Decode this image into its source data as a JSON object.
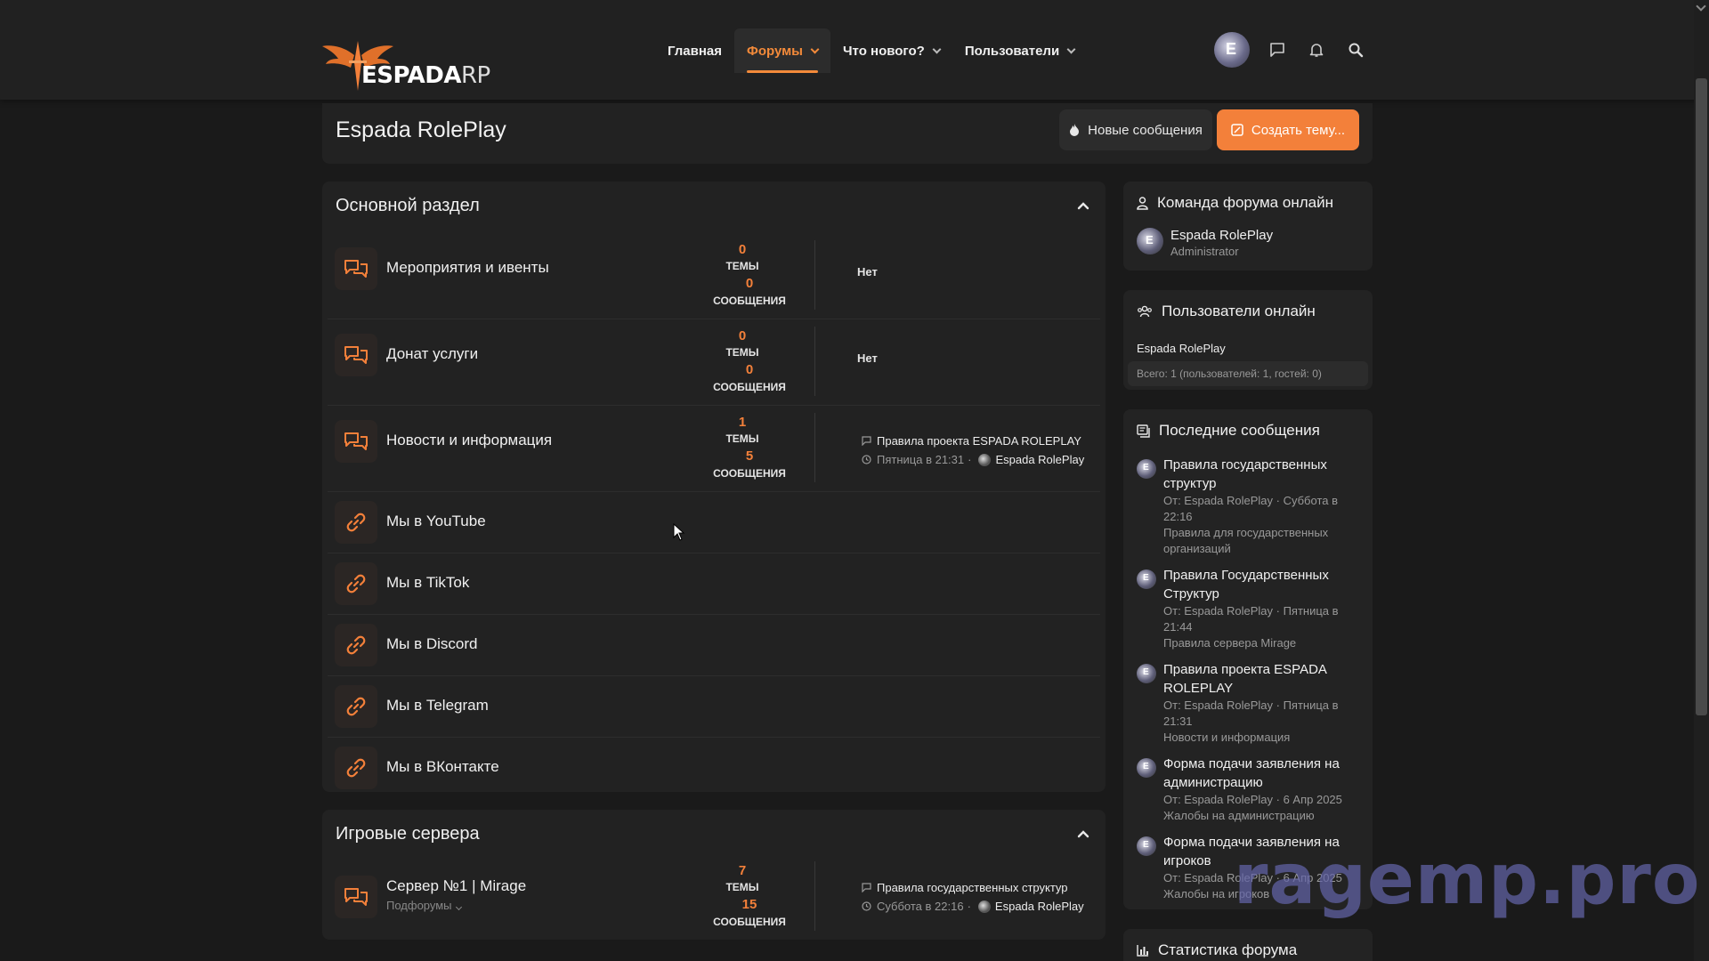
{
  "colors": {
    "accent": "#f3803a",
    "background": "#1a1a1a",
    "panel": "#222222"
  },
  "header": {
    "logo_main": "ESPADA",
    "logo_suffix": "RP",
    "nav": [
      {
        "label": "Главная"
      },
      {
        "label": "Форумы"
      },
      {
        "label": "Что нового?"
      },
      {
        "label": "Пользователи"
      }
    ],
    "icons": [
      "avatar",
      "chat-icon",
      "bell-icon",
      "search-icon"
    ]
  },
  "title_bar": {
    "title": "Espada RolePlay",
    "new_posts_label": "Новые сообщения",
    "create_thread_label": "Создать тему..."
  },
  "main_section": {
    "title": "Основной раздел",
    "nodes": [
      {
        "title": "Мероприятия и ивенты",
        "threads": "0",
        "threads_label": "ТЕМЫ",
        "messages": "0",
        "messages_label": "СООБЩЕНИЯ",
        "last": "Нет"
      },
      {
        "title": "Донат услуги",
        "threads": "0",
        "threads_label": "ТЕМЫ",
        "messages": "0",
        "messages_label": "СООБЩЕНИЯ",
        "last": "Нет"
      },
      {
        "title": "Новости и информация",
        "threads": "1",
        "threads_label": "ТЕМЫ",
        "messages": "5",
        "messages_label": "СООБЩЕНИЯ",
        "last_title": "Правила проекта ESPADA ROLEPLAY",
        "last_date": "Пятница в 21:31",
        "last_user": "Espada RolePlay"
      }
    ],
    "links": [
      {
        "title": "Мы в YouTube"
      },
      {
        "title": "Мы в TikTok"
      },
      {
        "title": "Мы в Discord"
      },
      {
        "title": "Мы в Telegram"
      },
      {
        "title": "Мы в ВКонтакте"
      }
    ]
  },
  "servers_section": {
    "title": "Игровые сервера",
    "nodes": [
      {
        "title": "Сервер №1 | Mirage",
        "subforums": "Подфорумы",
        "threads": "7",
        "threads_label": "ТЕМЫ",
        "messages": "15",
        "messages_label": "СООБЩЕНИЯ",
        "last_title": "Правила государственных структур",
        "last_date": "Суббота в 22:16",
        "last_user": "Espada RolePlay"
      }
    ]
  },
  "sidebar": {
    "team": {
      "title": "Команда форума онлайн",
      "name": "Espada RolePlay",
      "role": "Administrator"
    },
    "online": {
      "title": "Пользователи онлайн",
      "name": "Espada RolePlay",
      "total": "Всего: 1 (пользователей: 1, гостей: 0)"
    },
    "latest": {
      "title": "Последние сообщения",
      "posts": [
        {
          "title": "Правила государственных структур",
          "meta": "От: Espada RolePlay · Суббота в 22:16",
          "forum": "Правила для государственных организаций"
        },
        {
          "title": "Правила Государственных Структур",
          "meta": "От: Espada RolePlay · Пятница в 21:44",
          "forum": "Правила сервера Mirage"
        },
        {
          "title": "Правила проекта ESPADA ROLEPLAY",
          "meta": "От: Espada RolePlay · Пятница в 21:31",
          "forum": "Новости и информация"
        },
        {
          "title": "Форма подачи заявления на администрацию",
          "meta": "От: Espada RolePlay · 6 Апр 2025",
          "forum": "Жалобы на администрацию"
        },
        {
          "title": "Форма подачи заявления на игроков",
          "meta": "От: Espada RolePlay · 6 Апр 2025",
          "forum": "Жалобы на игроков"
        }
      ]
    },
    "stats": {
      "title": "Статистика форума"
    }
  },
  "watermark": "ragemp.pro"
}
